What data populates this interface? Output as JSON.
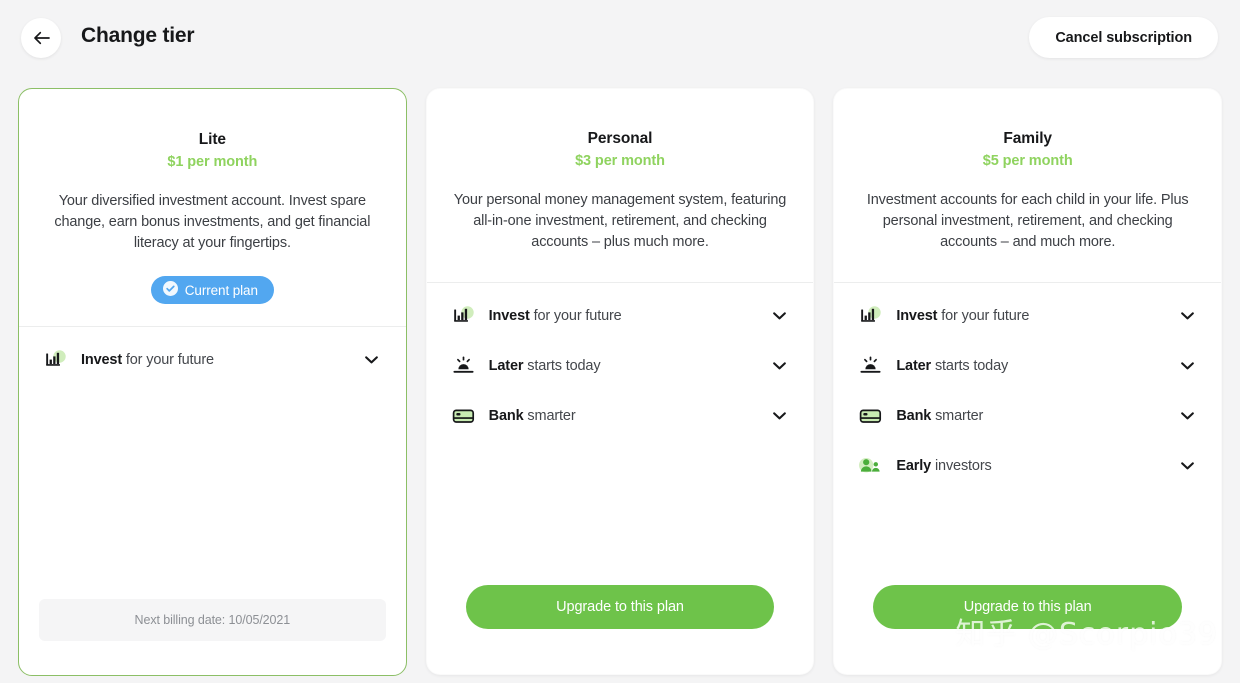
{
  "header": {
    "back_icon": "arrow-left-icon",
    "title": "Change tier",
    "cancel_label": "Cancel subscription"
  },
  "colors": {
    "accent_green": "#6ec34a",
    "price_green": "#8fd35f",
    "current_blue": "#52a7f0",
    "card_border_green": "#8cbf66",
    "page_bg": "#f4f4f5"
  },
  "plans": [
    {
      "name": "Lite",
      "price": "$1 per month",
      "description": "Your diversified investment account. Invest spare change, earn bonus investments, and get financial literacy at your fingertips.",
      "is_current": true,
      "badge_label": "Current plan",
      "badge_icon": "check-circle-icon",
      "features": [
        {
          "icon": "invest-chart-icon",
          "bold": "Invest",
          "rest": " for your future",
          "chevron": "chevron-down-icon"
        }
      ],
      "footer_note": "Next billing date: 10/05/2021"
    },
    {
      "name": "Personal",
      "price": "$3 per month",
      "description": "Your personal money management system, featuring all-in-one investment, retirement, and checking accounts – plus much more.",
      "is_current": false,
      "features": [
        {
          "icon": "invest-chart-icon",
          "bold": "Invest",
          "rest": " for your future",
          "chevron": "chevron-down-icon"
        },
        {
          "icon": "later-sunrise-icon",
          "bold": "Later",
          "rest": " starts today",
          "chevron": "chevron-down-icon"
        },
        {
          "icon": "bank-card-icon",
          "bold": "Bank",
          "rest": " smarter",
          "chevron": "chevron-down-icon"
        }
      ],
      "cta_label": "Upgrade to this plan"
    },
    {
      "name": "Family",
      "price": "$5 per month",
      "description": "Investment accounts for each child in your life. Plus personal investment, retirement, and checking accounts – and much more.",
      "is_current": false,
      "features": [
        {
          "icon": "invest-chart-icon",
          "bold": "Invest",
          "rest": " for your future",
          "chevron": "chevron-down-icon"
        },
        {
          "icon": "later-sunrise-icon",
          "bold": "Later",
          "rest": " starts today",
          "chevron": "chevron-down-icon"
        },
        {
          "icon": "bank-card-icon",
          "bold": "Bank",
          "rest": " smarter",
          "chevron": "chevron-down-icon"
        },
        {
          "icon": "early-people-icon",
          "bold": "Early",
          "rest": " investors",
          "chevron": "chevron-down-icon"
        }
      ],
      "cta_label": "Upgrade to this plan"
    }
  ],
  "watermark": "知乎 @Scorpio39"
}
